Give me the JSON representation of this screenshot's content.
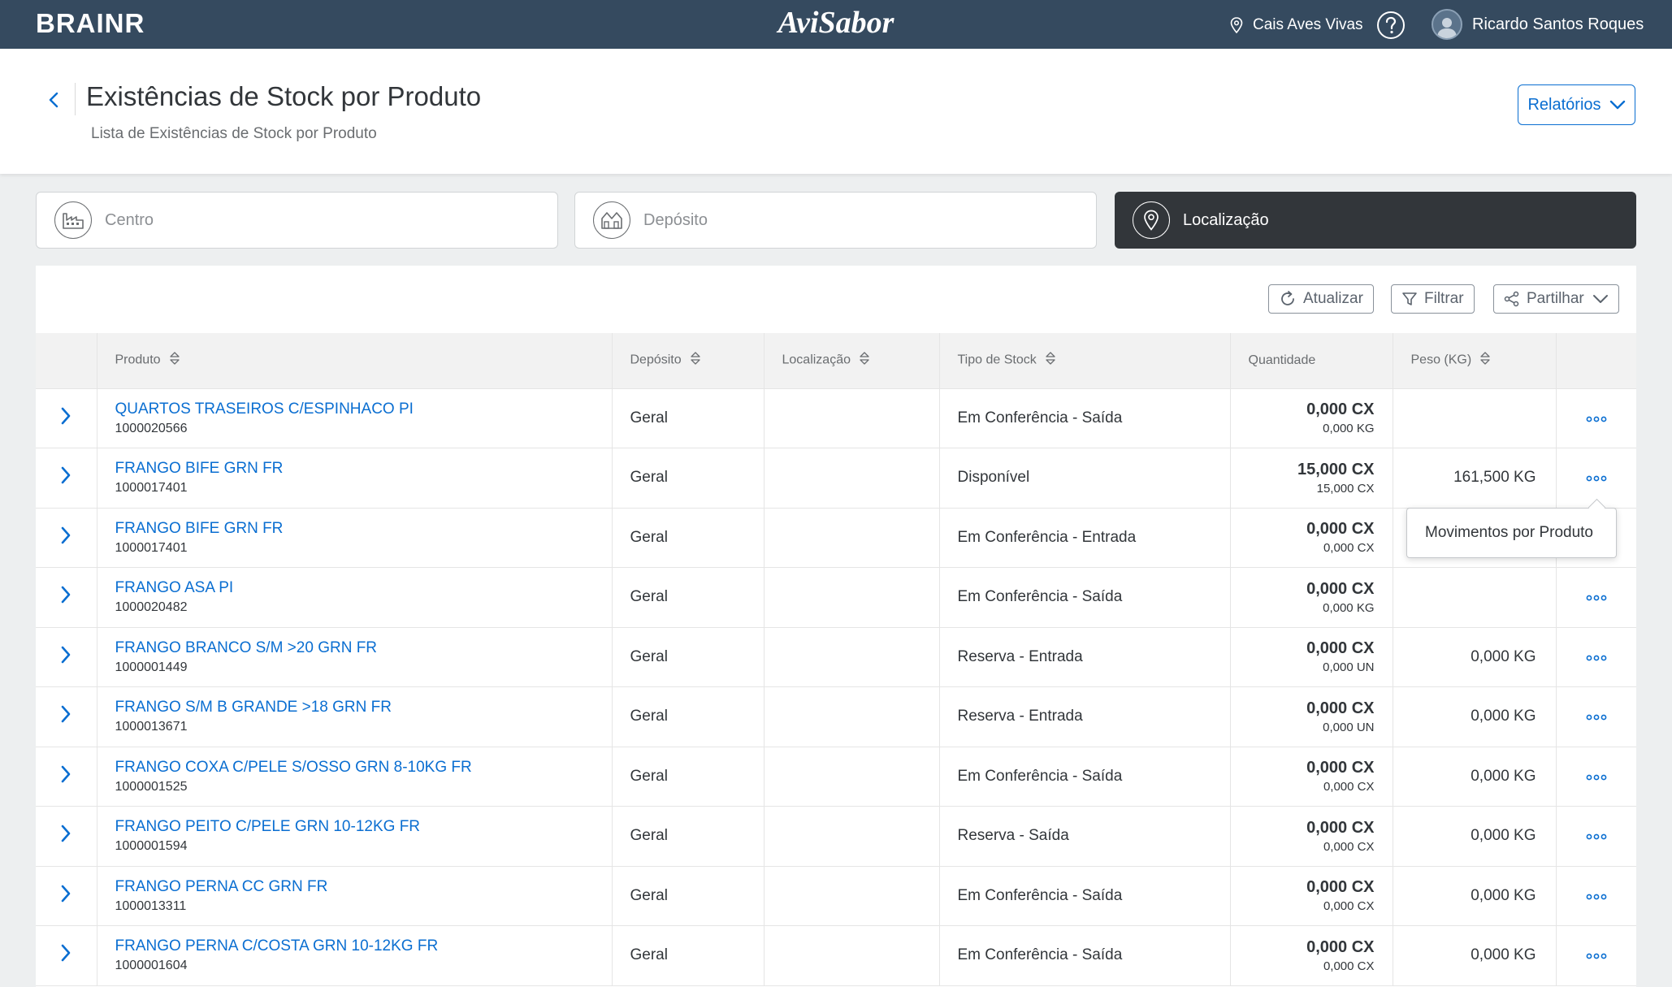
{
  "topbar": {
    "brand": "BRAINR",
    "logo": "AviSabor",
    "location": "Cais Aves Vivas",
    "user_name": "Ricardo Santos Roques"
  },
  "header": {
    "title": "Existências de Stock por Produto",
    "subtitle": "Lista de Existências de Stock por Produto",
    "reports_label": "Relatórios"
  },
  "filters": {
    "centro": "Centro",
    "deposito": "Depósito",
    "localizacao": "Localização"
  },
  "toolbar": {
    "refresh_label": "Atualizar",
    "filter_label": "Filtrar",
    "share_label": "Partilhar"
  },
  "table": {
    "columns": {
      "produto": "Produto",
      "deposito": "Depósito",
      "localizacao": "Localização",
      "tipo": "Tipo de Stock",
      "quantidade": "Quantidade",
      "peso": "Peso (KG)"
    },
    "rows": [
      {
        "name": "QUARTOS TRASEIROS C/ESPINHACO PI",
        "code": "1000020566",
        "deposito": "Geral",
        "localizacao": "",
        "tipo": "Em Conferência - Saída",
        "qty": "0,000 CX",
        "qty_sub": "0,000 KG",
        "peso": ""
      },
      {
        "name": "FRANGO BIFE GRN FR",
        "code": "1000017401",
        "deposito": "Geral",
        "localizacao": "",
        "tipo": "Disponível",
        "qty": "15,000 CX",
        "qty_sub": "15,000 CX",
        "peso": "161,500 KG"
      },
      {
        "name": "FRANGO BIFE GRN FR",
        "code": "1000017401",
        "deposito": "Geral",
        "localizacao": "",
        "tipo": "Em Conferência - Entrada",
        "qty": "0,000 CX",
        "qty_sub": "0,000 CX",
        "peso": ""
      },
      {
        "name": "FRANGO ASA PI",
        "code": "1000020482",
        "deposito": "Geral",
        "localizacao": "",
        "tipo": "Em Conferência - Saída",
        "qty": "0,000 CX",
        "qty_sub": "0,000 KG",
        "peso": ""
      },
      {
        "name": "FRANGO BRANCO S/M >20 GRN FR",
        "code": "1000001449",
        "deposito": "Geral",
        "localizacao": "",
        "tipo": "Reserva - Entrada",
        "qty": "0,000 CX",
        "qty_sub": "0,000 UN",
        "peso": "0,000 KG"
      },
      {
        "name": "FRANGO S/M B GRANDE >18 GRN FR",
        "code": "1000013671",
        "deposito": "Geral",
        "localizacao": "",
        "tipo": "Reserva - Entrada",
        "qty": "0,000 CX",
        "qty_sub": "0,000 UN",
        "peso": "0,000 KG"
      },
      {
        "name": "FRANGO COXA C/PELE S/OSSO GRN 8-10KG FR",
        "code": "1000001525",
        "deposito": "Geral",
        "localizacao": "",
        "tipo": "Em Conferência - Saída",
        "qty": "0,000 CX",
        "qty_sub": "0,000 CX",
        "peso": "0,000 KG"
      },
      {
        "name": "FRANGO PEITO C/PELE GRN 10-12KG FR",
        "code": "1000001594",
        "deposito": "Geral",
        "localizacao": "",
        "tipo": "Reserva - Saída",
        "qty": "0,000 CX",
        "qty_sub": "0,000 CX",
        "peso": "0,000 KG"
      },
      {
        "name": "FRANGO PERNA CC GRN FR",
        "code": "1000013311",
        "deposito": "Geral",
        "localizacao": "",
        "tipo": "Em Conferência - Saída",
        "qty": "0,000 CX",
        "qty_sub": "0,000 CX",
        "peso": "0,000 KG"
      },
      {
        "name": "FRANGO PERNA C/COSTA GRN 10-12KG FR",
        "code": "1000001604",
        "deposito": "Geral",
        "localizacao": "",
        "tipo": "Em Conferência - Saída",
        "qty": "0,000 CX",
        "qty_sub": "0,000 CX",
        "peso": "0,000 KG"
      }
    ]
  },
  "popover": {
    "label": "Movimentos por Produto"
  },
  "colors": {
    "shell": "#354a5f",
    "accent": "#0a6ed1",
    "dark_tile": "#32363a"
  }
}
